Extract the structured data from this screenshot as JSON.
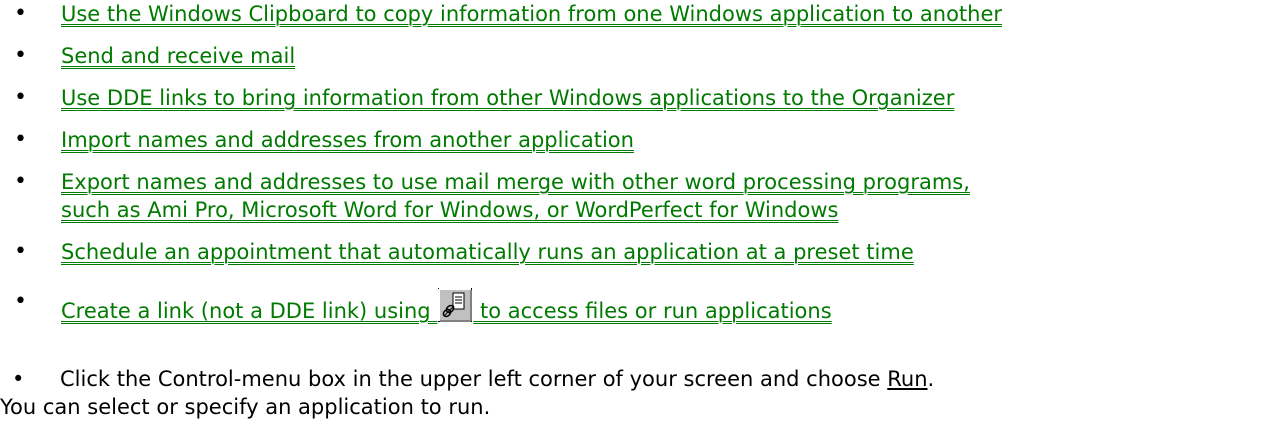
{
  "bullet_glyph": "•",
  "items": [
    {
      "text": "Use the Windows Clipboard to copy information from one Windows application to another"
    },
    {
      "text": "Send and receive mail"
    },
    {
      "text": "Use DDE links to bring information from other Windows applications to the Organizer"
    },
    {
      "text": "Import names and addresses from another application"
    },
    {
      "text": "Export names and addresses to use mail merge with other word processing programs,",
      "text_line2": "such as Ami Pro, Microsoft Word for Windows, or WordPerfect for Windows"
    },
    {
      "text": "Schedule an appointment that automatically runs an application at a preset time"
    },
    {
      "text_before_icon": "Create a link (not a DDE link) using ",
      "icon": "create-link-icon",
      "text_after_icon": " to access files or run applications"
    }
  ],
  "last": {
    "text_before": "Click the Control-menu box in the upper left corner of your screen and choose ",
    "run_label": "Run",
    "text_after": ".",
    "line2": "You can select or specify an application to run."
  },
  "colors": {
    "link": "#007a00",
    "text": "#000000",
    "background": "#ffffff"
  }
}
